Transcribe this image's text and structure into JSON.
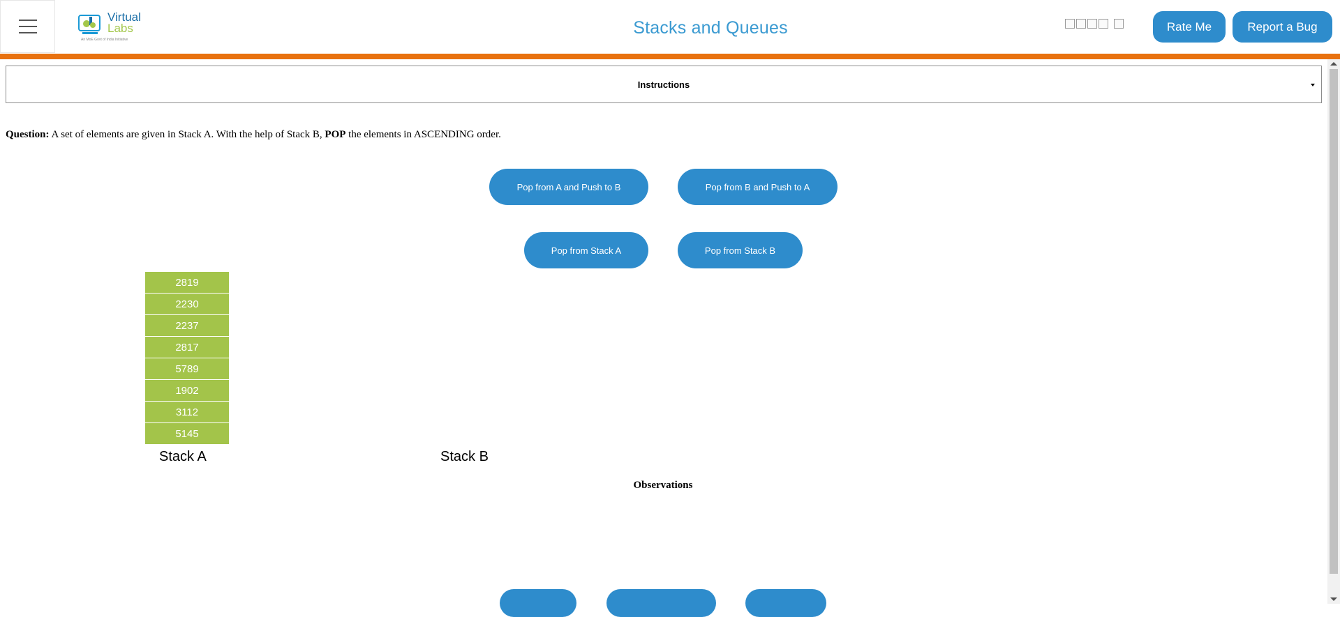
{
  "header": {
    "title": "Stacks and Queues",
    "logo_line1": "Virtual",
    "logo_line2": "Labs",
    "logo_tagline": "An MoE Govt of India Initiative",
    "rate_label": "Rate Me",
    "bug_label": "Report a Bug",
    "star_count": 5
  },
  "instructions": {
    "label": "Instructions"
  },
  "question": {
    "prefix": "Question:",
    "text_before": " A set of elements are given in Stack A. With the help of Stack B, ",
    "emphasis": "POP",
    "text_after": " the elements in ASCENDING order."
  },
  "buttons": {
    "pop_a_push_b": "Pop from A and Push to B",
    "pop_b_push_a": "Pop from B and Push to A",
    "pop_a": "Pop from Stack A",
    "pop_b": "Pop from Stack B"
  },
  "stack_a": {
    "label": "Stack A",
    "items": [
      "2819",
      "2230",
      "2237",
      "2817",
      "5789",
      "1902",
      "3112",
      "5145"
    ]
  },
  "stack_b": {
    "label": "Stack B",
    "items": []
  },
  "observations": {
    "label": "Observations"
  },
  "colors": {
    "accent": "#2e8ccc",
    "title": "#3a9ad1",
    "orange_bar": "#e8710f",
    "stack_cell": "#a3c44a"
  }
}
